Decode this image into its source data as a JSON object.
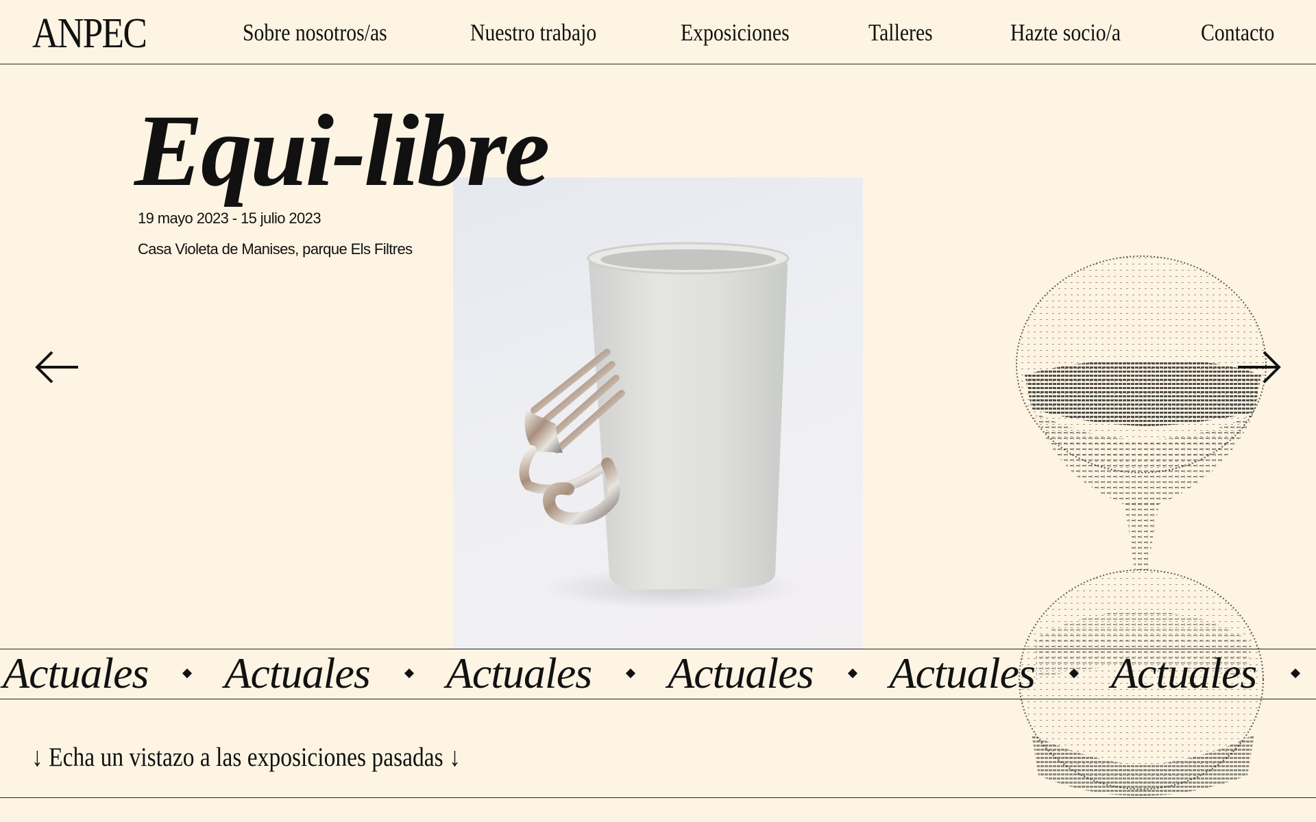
{
  "brand": {
    "logo_text": "ANPEC"
  },
  "nav": {
    "items": [
      {
        "label": "Sobre nosotros/as"
      },
      {
        "label": "Nuestro trabajo"
      },
      {
        "label": "Exposiciones"
      },
      {
        "label": "Talleres"
      },
      {
        "label": "Hazte socio/a"
      },
      {
        "label": "Contacto"
      }
    ]
  },
  "exhibition": {
    "title": "Equi-libre",
    "dates": "19 mayo 2023 - 15 julio 2023",
    "venue": "Casa Violeta de Manises, parque Els Filtres"
  },
  "carousel": {
    "prev_icon": "arrow-left-icon",
    "next_icon": "arrow-right-icon"
  },
  "marquee": {
    "word": "Actuales",
    "separator_icon": "diamond-icon"
  },
  "past": {
    "label": "↓ Echa un vistazo a las exposiciones pasadas ↓"
  },
  "colors": {
    "background": "#fdf4e3",
    "text": "#111111"
  }
}
